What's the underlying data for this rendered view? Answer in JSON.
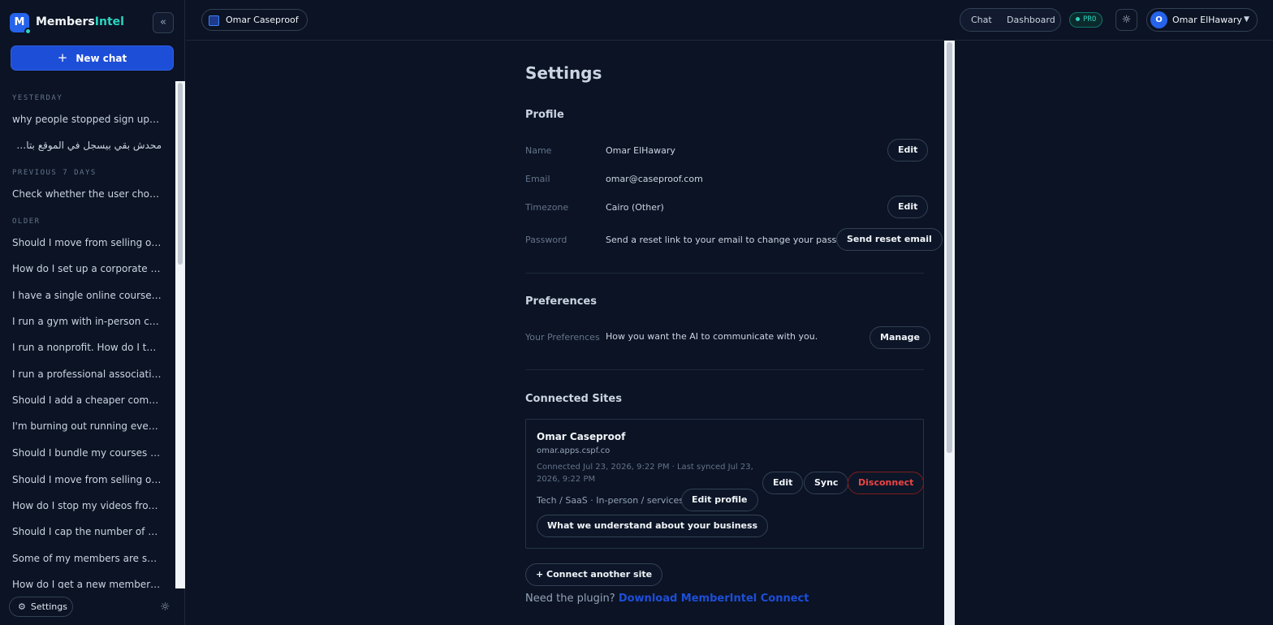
{
  "app": {
    "brand_prefix": "Members",
    "brand_suffix": "Intel",
    "logo_letter": "M"
  },
  "sidebar": {
    "new_chat_label": "New chat",
    "groups": [
      {
        "label": "YESTERDAY",
        "items": [
          "why people stopped sign up to my website",
          "محدش بقي بيسجل في الموقع بتاعي مش فاهم ليه"
        ]
      },
      {
        "label": "PREVIOUS 7 DAYS",
        "items": [
          "Check whether the user chose a valid option"
        ]
      },
      {
        "label": "OLDER",
        "items": [
          "Should I move from selling one-off courses to a membership?",
          "How do I set up a corporate or group membership?",
          "I have a single online course. Should I turn it into a membership?",
          "I run a gym with in-person classes. How do I sell memberships online?",
          "I run a nonprofit. How do I turn our donors into members?",
          "I run a professional association with annual dues. How do I manage renewals?",
          "Should I add a cheaper community-only tier?",
          "I'm burning out running everything myself. What should I automate?",
          "Should I bundle my courses together into one offer?",
          "Should I move from selling one-off products to subscriptions?",
          "How do I stop my videos from being downloaded?",
          "Should I cap the number of devices per account?",
          "Some of my members are sharing their logins. What can I do?",
          "How do I get a new member to their first win quickly?"
        ]
      }
    ],
    "settings_label": "Settings"
  },
  "topbar": {
    "site_name": "Omar Caseproof",
    "nav": [
      "Chat",
      "Dashboard"
    ],
    "plan_badge": "PRO",
    "user_initial": "O",
    "user_name": "Omar ElHawary"
  },
  "settings": {
    "title": "Settings",
    "profile": {
      "heading": "Profile",
      "rows": [
        {
          "label": "Name",
          "value": "Omar ElHawary",
          "action": "Edit"
        },
        {
          "label": "Email",
          "value": "omar@caseproof.com",
          "action": ""
        },
        {
          "label": "Timezone",
          "value": "Cairo (Other)",
          "action": "Edit"
        },
        {
          "label": "Password",
          "value": "Send a reset link to your email to change your password.",
          "action": "Send reset email"
        }
      ]
    },
    "preferences": {
      "heading": "Preferences",
      "label": "Your Preferences",
      "value": "How you want the AI to communicate with you.",
      "action": "Manage"
    },
    "connected_sites": {
      "heading": "Connected Sites",
      "site": {
        "name": "Omar Caseproof",
        "url": "omar.apps.cspf.co",
        "meta": "Connected Jul 23, 2026, 9:22 PM · Last synced Jul 23, 2026, 9:22 PM",
        "tags": "Tech / SaaS · In-person / services",
        "edit_profile": "Edit profile",
        "understand": "What we understand about your business",
        "edit": "Edit",
        "sync": "Sync",
        "disconnect": "Disconnect"
      },
      "connect_another": "+ Connect another site",
      "plugin_prompt": "Need the plugin?",
      "plugin_link": "Download MemberIntel Connect"
    }
  },
  "colors": {
    "background": "#0b1324",
    "primary": "#1d4ed8",
    "accent": "#2dd4bf",
    "danger": "#ef4444"
  }
}
